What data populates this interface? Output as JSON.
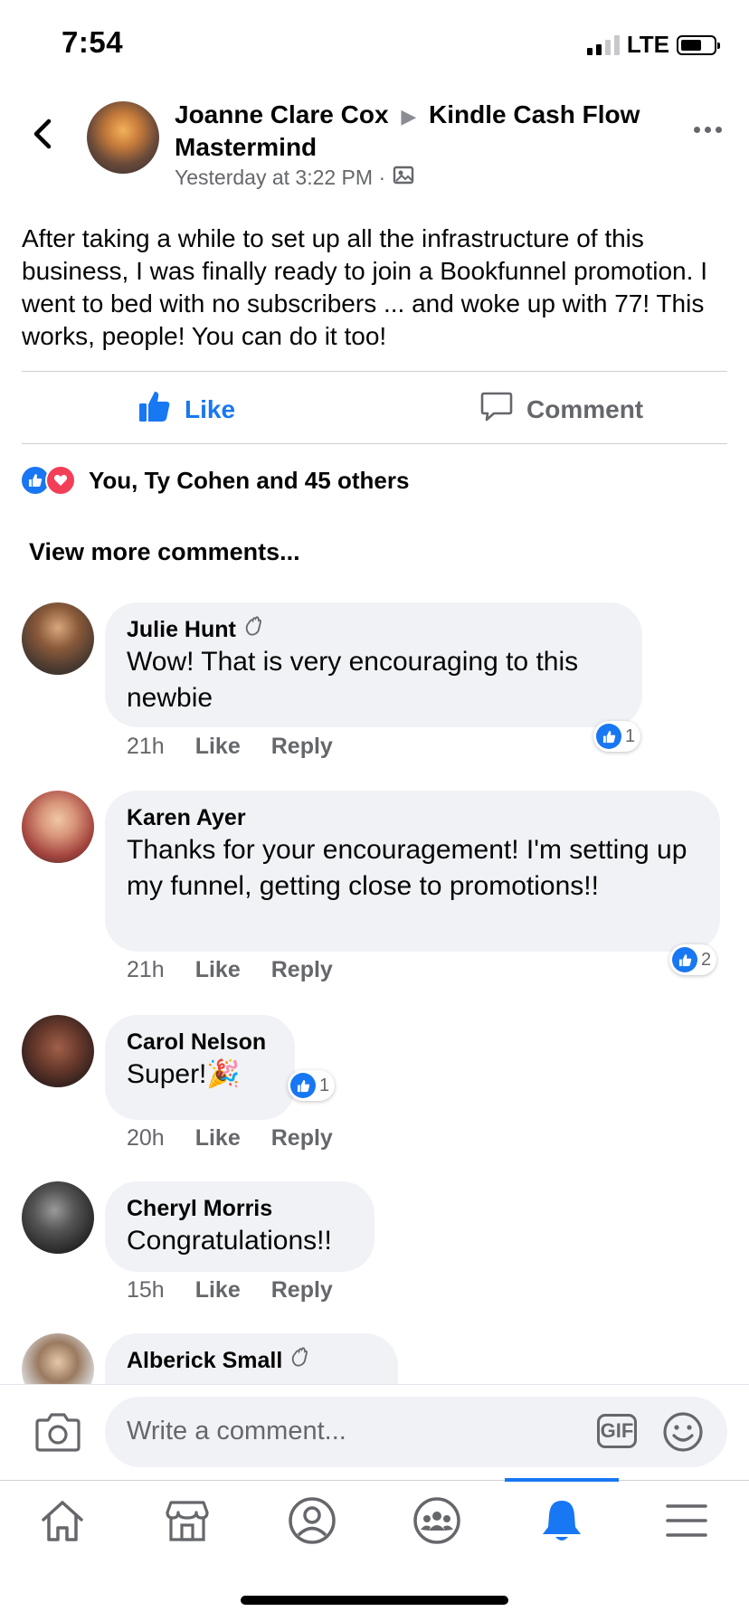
{
  "status": {
    "time": "7:54",
    "network": "LTE"
  },
  "post": {
    "author": "Joanne Clare Cox",
    "group": "Kindle Cash Flow Mastermind",
    "timestamp": "Yesterday at 3:22 PM ·",
    "text": "After taking a while to set up all the infrastructure of this business, I was finally ready to join a Bookfunnel promotion. I went to bed with no subscribers ... and woke up with 77! This works, people! You can do it too!",
    "like_label": "Like",
    "comment_label": "Comment",
    "reactions_text": "You, Ty Cohen and 45 others",
    "view_more": "View more comments..."
  },
  "comments": [
    {
      "name": "Julie Hunt",
      "text": "Wow! That is very encouraging to this newbie",
      "time": "21h",
      "like": "Like",
      "reply": "Reply",
      "reactions": "1"
    },
    {
      "name": "Karen Ayer",
      "text": "Thanks for your encouragement! I'm setting up my funnel, getting close to promotions!!",
      "time": "21h",
      "like": "Like",
      "reply": "Reply",
      "reactions": "2"
    },
    {
      "name": "Carol Nelson",
      "text": "Super!",
      "emoji": "🎉",
      "time": "20h",
      "like": "Like",
      "reply": "Reply",
      "reactions": "1"
    },
    {
      "name": "Cheryl Morris",
      "text": "Congratulations!!",
      "time": "15h",
      "like": "Like",
      "reply": "Reply"
    },
    {
      "name": "Alberick Small"
    }
  ],
  "composer": {
    "placeholder": "Write a comment...",
    "gif_label": "GIF"
  },
  "colors": {
    "accent": "#1877f2",
    "love": "#f33e58",
    "bubble": "#f0f2f5",
    "muted": "#65676b"
  },
  "icons": [
    "back-icon",
    "photos-icon",
    "more-icon",
    "like-thumb-icon",
    "comment-icon",
    "wave-icon",
    "camera-icon",
    "emoji-icon",
    "home-icon",
    "marketplace-icon",
    "profile-icon",
    "groups-icon",
    "notifications-icon",
    "menu-icon"
  ]
}
